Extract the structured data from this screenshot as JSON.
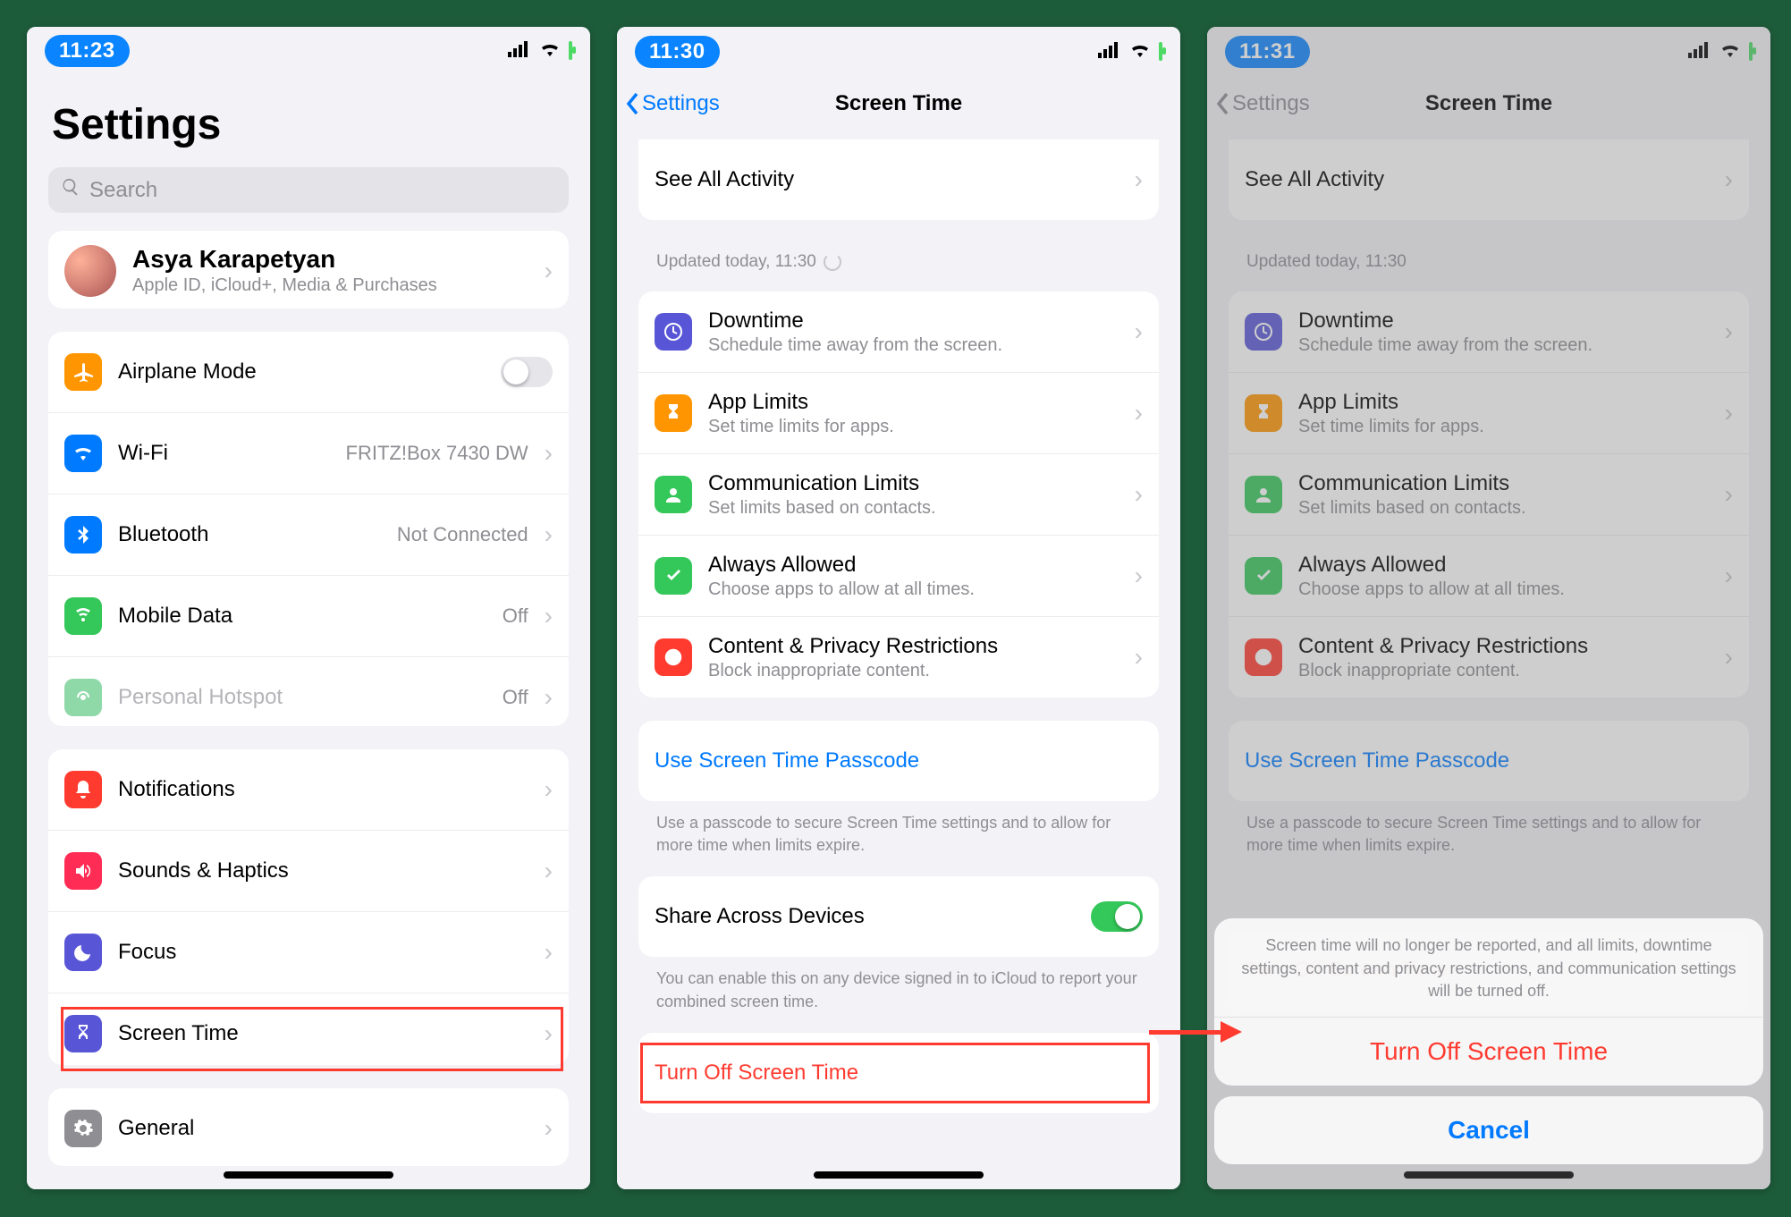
{
  "screen1": {
    "time": "11:23",
    "title": "Settings",
    "search_placeholder": "Search",
    "apple_id": {
      "name": "Asya Karapetyan",
      "subtitle": "Apple ID, iCloud+, Media & Purchases"
    },
    "rows": {
      "airplane": {
        "label": "Airplane Mode"
      },
      "wifi": {
        "label": "Wi-Fi",
        "value": "FRITZ!Box 7430 DW"
      },
      "bluetooth": {
        "label": "Bluetooth",
        "value": "Not Connected"
      },
      "mobile_data": {
        "label": "Mobile Data",
        "value": "Off"
      },
      "hotspot": {
        "label": "Personal Hotspot",
        "value": "Off"
      },
      "notifications": {
        "label": "Notifications"
      },
      "sounds": {
        "label": "Sounds & Haptics"
      },
      "focus": {
        "label": "Focus"
      },
      "screentime": {
        "label": "Screen Time"
      },
      "general": {
        "label": "General"
      }
    }
  },
  "screen2": {
    "time": "11:30",
    "back": "Settings",
    "title": "Screen Time",
    "see_all": "See All Activity",
    "updated": "Updated today, 11:30",
    "items": {
      "downtime": {
        "label": "Downtime",
        "sub": "Schedule time away from the screen."
      },
      "applimits": {
        "label": "App Limits",
        "sub": "Set time limits for apps."
      },
      "comm": {
        "label": "Communication Limits",
        "sub": "Set limits based on contacts."
      },
      "always": {
        "label": "Always Allowed",
        "sub": "Choose apps to allow at all times."
      },
      "content": {
        "label": "Content & Privacy Restrictions",
        "sub": "Block inappropriate content."
      }
    },
    "passcode_link": "Use Screen Time Passcode",
    "passcode_footer": "Use a passcode to secure Screen Time settings and to allow for more time when limits expire.",
    "share": "Share Across Devices",
    "share_footer": "You can enable this on any device signed in to iCloud to report your combined screen time.",
    "turn_off": "Turn Off Screen Time"
  },
  "screen3": {
    "time": "11:31",
    "back": "Settings",
    "title": "Screen Time",
    "see_all": "See All Activity",
    "updated": "Updated today, 11:30",
    "items": {
      "downtime": {
        "label": "Downtime",
        "sub": "Schedule time away from the screen."
      },
      "applimits": {
        "label": "App Limits",
        "sub": "Set time limits for apps."
      },
      "comm": {
        "label": "Communication Limits",
        "sub": "Set limits based on contacts."
      },
      "always": {
        "label": "Always Allowed",
        "sub": "Choose apps to allow at all times."
      },
      "content": {
        "label": "Content & Privacy Restrictions",
        "sub": "Block inappropriate content."
      }
    },
    "passcode_link": "Use Screen Time Passcode",
    "passcode_footer": "Use a passcode to secure Screen Time settings and to allow for more time when limits expire.",
    "turn_off": "Turn Off Screen Time",
    "sheet": {
      "message": "Screen time will no longer be reported, and all limits, downtime settings, content and privacy restrictions, and communication settings will be turned off.",
      "action": "Turn Off Screen Time",
      "cancel": "Cancel"
    }
  }
}
